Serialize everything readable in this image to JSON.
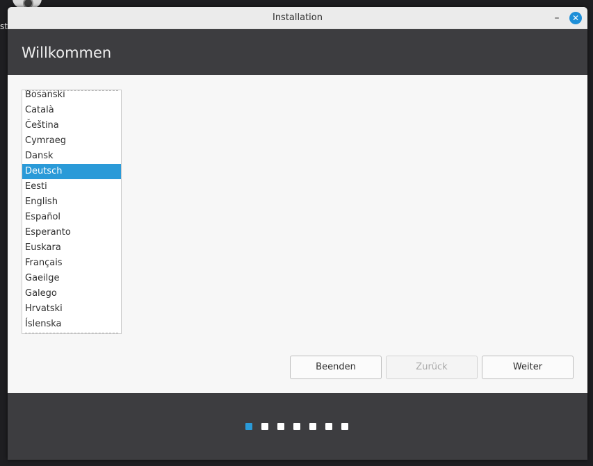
{
  "desktop": {
    "label": "st"
  },
  "window": {
    "title": "Installation",
    "minimize_glyph": "–",
    "close_glyph": "✕"
  },
  "header": {
    "title": "Willkommen"
  },
  "languages": [
    "Bosanski",
    "Català",
    "Čeština",
    "Cymraeg",
    "Dansk",
    "Deutsch",
    "Eesti",
    "English",
    "Español",
    "Esperanto",
    "Euskara",
    "Français",
    "Gaeilge",
    "Galego",
    "Hrvatski",
    "Íslenska"
  ],
  "selected_language": "Deutsch",
  "buttons": {
    "quit": "Beenden",
    "back": "Zurück",
    "next": "Weiter"
  },
  "progress": {
    "total_steps": 7,
    "current_step": 1
  },
  "colors": {
    "accent": "#2a9ad8",
    "header_bg": "#3d3d40"
  }
}
